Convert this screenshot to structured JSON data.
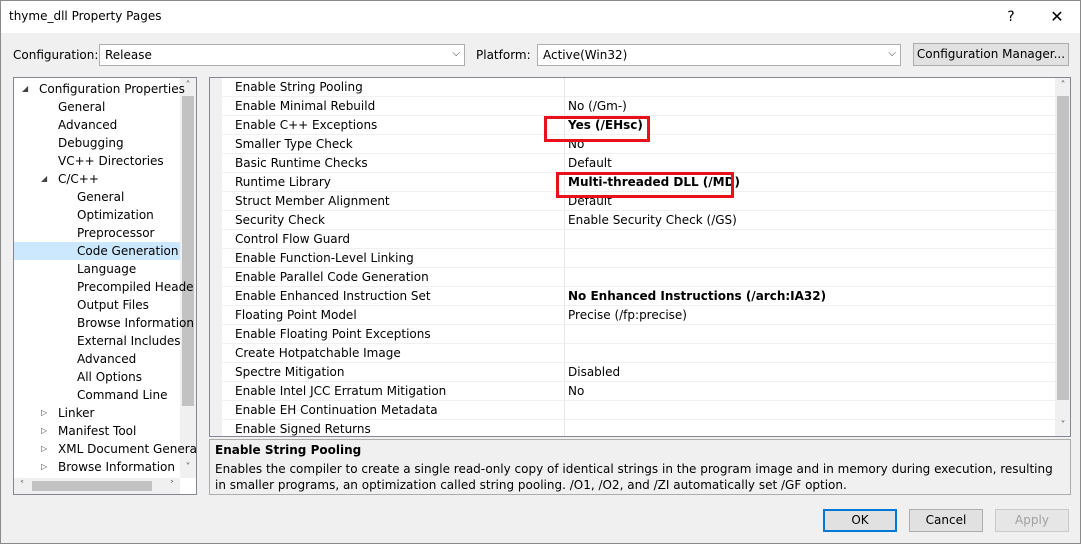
{
  "window": {
    "title": "thyme_dll Property Pages",
    "help": "?",
    "close": "✕"
  },
  "toolbar": {
    "configuration_label": "Configuration:",
    "configuration_value": "Release",
    "platform_label": "Platform:",
    "platform_value": "Active(Win32)",
    "config_manager": "Configuration Manager..."
  },
  "tree": {
    "items": [
      "Configuration Properties",
      "General",
      "Advanced",
      "Debugging",
      "VC++ Directories",
      "C/C++",
      "General",
      "Optimization",
      "Preprocessor",
      "Code Generation",
      "Language",
      "Precompiled Heade",
      "Output Files",
      "Browse Information",
      "External Includes",
      "Advanced",
      "All Options",
      "Command Line",
      "Linker",
      "Manifest Tool",
      "XML Document Genera",
      "Browse Information"
    ],
    "selected": "Code Generation"
  },
  "properties": [
    {
      "name": "Enable String Pooling",
      "value": ""
    },
    {
      "name": "Enable Minimal Rebuild",
      "value": "No (/Gm-)"
    },
    {
      "name": "Enable C++ Exceptions",
      "value": "Yes (/EHsc)"
    },
    {
      "name": "Smaller Type Check",
      "value": "No"
    },
    {
      "name": "Basic Runtime Checks",
      "value": "Default"
    },
    {
      "name": "Runtime Library",
      "value": "Multi-threaded DLL (/MD)"
    },
    {
      "name": "Struct Member Alignment",
      "value": "Default"
    },
    {
      "name": "Security Check",
      "value": "Enable Security Check (/GS)"
    },
    {
      "name": "Control Flow Guard",
      "value": ""
    },
    {
      "name": "Enable Function-Level Linking",
      "value": ""
    },
    {
      "name": "Enable Parallel Code Generation",
      "value": ""
    },
    {
      "name": "Enable Enhanced Instruction Set",
      "value": "No Enhanced Instructions (/arch:IA32)"
    },
    {
      "name": "Floating Point Model",
      "value": "Precise (/fp:precise)"
    },
    {
      "name": "Enable Floating Point Exceptions",
      "value": ""
    },
    {
      "name": "Create Hotpatchable Image",
      "value": ""
    },
    {
      "name": "Spectre Mitigation",
      "value": "Disabled"
    },
    {
      "name": "Enable Intel JCC Erratum Mitigation",
      "value": "No"
    },
    {
      "name": "Enable EH Continuation Metadata",
      "value": ""
    },
    {
      "name": "Enable Signed Returns",
      "value": ""
    }
  ],
  "description": {
    "title": "Enable String Pooling",
    "text": "Enables the compiler to create a single read-only copy of identical strings in the program image and in memory during execution, resulting in smaller programs, an optimization called string pooling. /O1, /O2, and /ZI  automatically set /GF option."
  },
  "buttons": {
    "ok": "OK",
    "cancel": "Cancel",
    "apply": "Apply"
  },
  "colors": {
    "highlight_box": "#e8111b",
    "selection": "#cce8ff",
    "default_button_border": "#0078d7"
  }
}
